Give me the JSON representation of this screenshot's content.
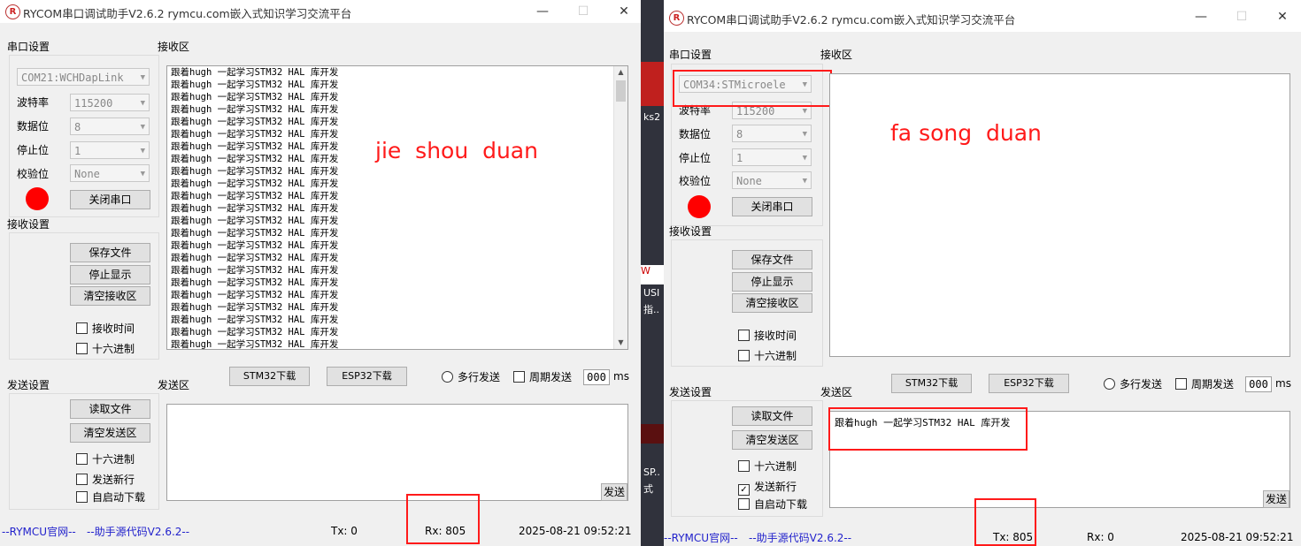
{
  "left_window": {
    "title": "RYCOM串口调试助手V2.6.2 rymcu.com嵌入式知识学习交流平台",
    "serial_group": "串口设置",
    "receive_area_label": "接收区",
    "port": "COM21:WCHDapLink",
    "baud_label": "波特率",
    "baud": "115200",
    "data_bits_label": "数据位",
    "data_bits": "8",
    "stop_bits_label": "停止位",
    "stop_bits": "1",
    "parity_label": "校验位",
    "parity": "None",
    "close_port": "关闭串口",
    "recv_settings": "接收设置",
    "save_file": "保存文件",
    "stop_display": "停止显示",
    "clear_recv": "清空接收区",
    "recv_time": "接收时间",
    "hex": "十六进制",
    "rx_lines": [
      "跟着hugh 一起学习STM32 HAL 库开发",
      "跟着hugh 一起学习STM32 HAL 库开发",
      "跟着hugh 一起学习STM32 HAL 库开发",
      "跟着hugh 一起学习STM32 HAL 库开发",
      "跟着hugh 一起学习STM32 HAL 库开发",
      "跟着hugh 一起学习STM32 HAL 库开发",
      "跟着hugh 一起学习STM32 HAL 库开发",
      "跟着hugh 一起学习STM32 HAL 库开发",
      "跟着hugh 一起学习STM32 HAL 库开发",
      "跟着hugh 一起学习STM32 HAL 库开发",
      "跟着hugh 一起学习STM32 HAL 库开发",
      "跟着hugh 一起学习STM32 HAL 库开发",
      "跟着hugh 一起学习STM32 HAL 库开发",
      "跟着hugh 一起学习STM32 HAL 库开发",
      "跟着hugh 一起学习STM32 HAL 库开发",
      "跟着hugh 一起学习STM32 HAL 库开发",
      "跟着hugh 一起学习STM32 HAL 库开发",
      "跟着hugh 一起学习STM32 HAL 库开发",
      "跟着hugh 一起学习STM32 HAL 库开发",
      "跟着hugh 一起学习STM32 HAL 库开发",
      "跟着hugh 一起学习STM32 HAL 库开发",
      "跟着hugh 一起学习STM32 HAL 库开发",
      "跟着hugh 一起学习STM32 HAL 库开发",
      "跟着hugh 一起学习STM32 HAL 库开发",
      "跟着hugh 一起学习STM32 HAL 库开发",
      "跟着hugh 一起学习STM32 HAL 库开发",
      "跟着hugh 一起学习STM32 HAL 库开发",
      "跟着hugh 一起学习STM32 HAL 库开发",
      "跟着hugh 一起学习STM32 HAL 库开发",
      "跟着hugh 一起学习STM32 HAL 库开发",
      "跟着hugh 一起学习STM32 HAL 库开发",
      "跟着hugh 一起学习STM32 HAL 库开发"
    ],
    "annotation": "jie  shou  duan",
    "stm32_download": "STM32下载",
    "esp32_download": "ESP32下载",
    "multi_send": "多行发送",
    "periodic_send": "周期发送",
    "period_value": "000",
    "ms": "ms",
    "send_settings": "发送设置",
    "send_area_label": "发送区",
    "read_file": "读取文件",
    "clear_send": "清空发送区",
    "send_hex": "十六进制",
    "send_newline": "发送新行",
    "auto_download": "自启动下载",
    "send_button": "发送",
    "send_text": "",
    "link_official": "--RYMCU官网--",
    "link_source": "--助手源代码V2.6.2--",
    "tx": "Tx: 0",
    "rx": "Rx: 805",
    "datetime": "2025-08-21 09:52:21"
  },
  "right_window": {
    "title": "RYCOM串口调试助手V2.6.2 rymcu.com嵌入式知识学习交流平台",
    "serial_group": "串口设置",
    "receive_area_label": "接收区",
    "port": "COM34:STMicroele",
    "baud_label": "波特率",
    "baud": "115200",
    "data_bits_label": "数据位",
    "data_bits": "8",
    "stop_bits_label": "停止位",
    "stop_bits": "1",
    "parity_label": "校验位",
    "parity": "None",
    "close_port": "关闭串口",
    "recv_settings": "接收设置",
    "save_file": "保存文件",
    "stop_display": "停止显示",
    "clear_recv": "清空接收区",
    "recv_time": "接收时间",
    "hex": "十六进制",
    "annotation": "fa song  duan",
    "stm32_download": "STM32下载",
    "esp32_download": "ESP32下载",
    "multi_send": "多行发送",
    "periodic_send": "周期发送",
    "period_value": "000",
    "ms": "ms",
    "send_settings": "发送设置",
    "send_area_label": "发送区",
    "read_file": "读取文件",
    "clear_send": "清空发送区",
    "send_hex": "十六进制",
    "send_newline": "发送新行",
    "send_newline_checked": "✓",
    "auto_download": "自启动下载",
    "send_button": "发送",
    "send_text": "跟着hugh 一起学习STM32 HAL 库开发",
    "link_official": "--RYMCU官网--",
    "link_source": "--助手源代码V2.6.2--",
    "tx": "Tx: 805",
    "rx": "Rx: 0",
    "datetime": "2025-08-21 09:52:21"
  },
  "window_controls": {
    "minimize": "—",
    "maximize": "☐",
    "close": "✕"
  },
  "desktop_fragments": [
    "ks2",
    "W",
    "USI",
    "指..",
    "SP..",
    "式"
  ],
  "colors": {
    "status_dot": "#ff0000",
    "annotation": "#ff1a1a",
    "link": "#2222cc"
  }
}
